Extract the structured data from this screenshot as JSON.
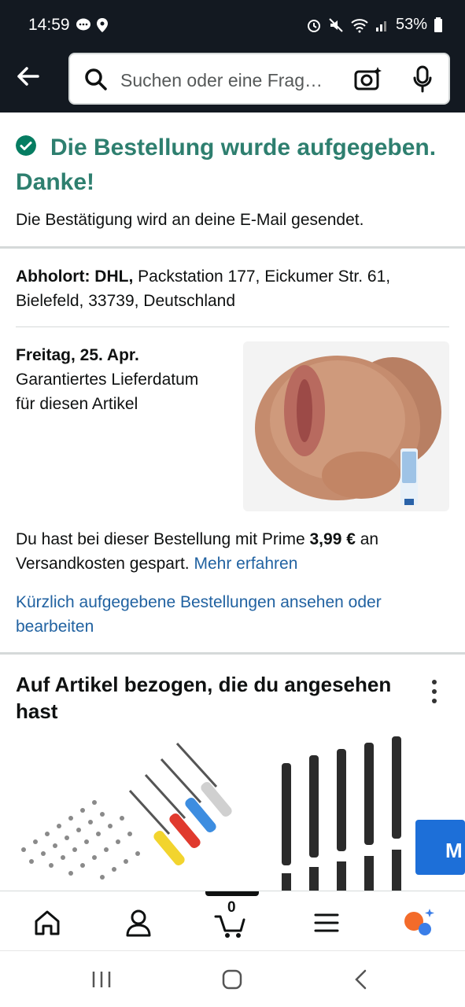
{
  "status_bar": {
    "time": "14:59",
    "battery": "53%"
  },
  "search": {
    "placeholder": "Suchen oder eine Frag…"
  },
  "confirmation": {
    "title": "Die Bestellung wurde aufgegeben. Danke!",
    "subtitle": "Die Bestätigung wird an deine E-Mail gesendet."
  },
  "pickup": {
    "label": "Abholort: DHL,",
    "address": " Packstation 177, Eickumer Str. 61, Bielefeld, 33739, Deutschland"
  },
  "delivery": {
    "date": "Freitag, 25. Apr.",
    "note": "Garantiertes Lieferdatum für diesen Artikel"
  },
  "prime": {
    "text_before": "Du hast bei dieser Bestellung mit Prime ",
    "amount": "3,99 €",
    "text_after": " an Versandkosten gespart. ",
    "link": "Mehr erfahren"
  },
  "recent_orders_link": "Kürzlich aufgegebene Bestellungen ansehen oder bearbeiten",
  "recommendations": {
    "title": "Auf Artikel bezogen, die du angesehen hast"
  },
  "bottom_nav": {
    "cart_count": "0",
    "items": [
      "home",
      "account",
      "cart",
      "menu",
      "rufus"
    ]
  },
  "colors": {
    "header_bg": "#131921",
    "success_green": "#2e7f6f",
    "link_blue": "#2162a1"
  }
}
